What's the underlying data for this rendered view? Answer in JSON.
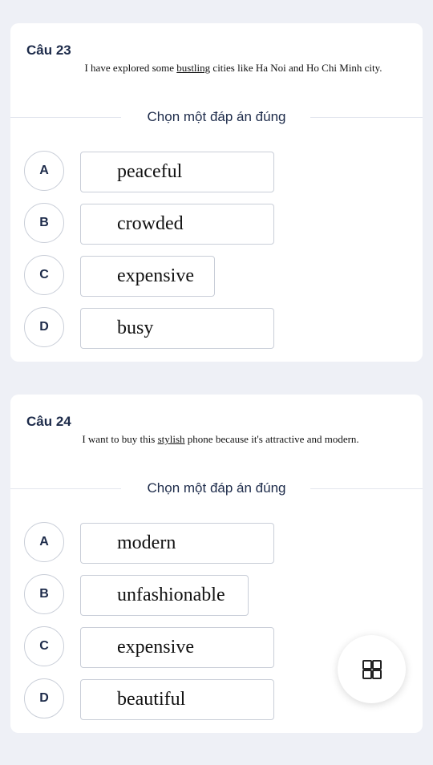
{
  "questions": [
    {
      "title": "Câu 23",
      "text_before": "I have explored some ",
      "underlined": "bustling",
      "text_after": " cities like Ha Noi and Ho Chi Minh city.",
      "instruction": "Chọn một đáp án đúng",
      "options": [
        {
          "letter": "A",
          "text": "peaceful"
        },
        {
          "letter": "B",
          "text": "crowded"
        },
        {
          "letter": "C",
          "text": "expensive"
        },
        {
          "letter": "D",
          "text": "busy"
        }
      ]
    },
    {
      "title": "Câu 24",
      "text_before": "I want to buy this ",
      "underlined": "stylish",
      "text_after": " phone because it's attractive and modern.",
      "instruction": "Chọn một đáp án đúng",
      "options": [
        {
          "letter": "A",
          "text": "modern"
        },
        {
          "letter": "B",
          "text": "unfashionable"
        },
        {
          "letter": "C",
          "text": "expensive"
        },
        {
          "letter": "D",
          "text": "beautiful"
        }
      ]
    }
  ],
  "fab": {
    "icon": "grid-icon"
  }
}
